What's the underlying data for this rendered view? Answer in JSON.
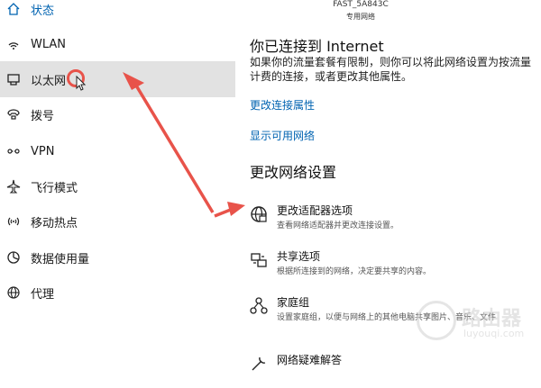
{
  "sidebar": {
    "items": [
      {
        "label": "状态",
        "icon": "home-icon"
      },
      {
        "label": "WLAN",
        "icon": "wifi-icon"
      },
      {
        "label": "以太网",
        "icon": "ethernet-icon"
      },
      {
        "label": "拨号",
        "icon": "dialup-icon"
      },
      {
        "label": "VPN",
        "icon": "vpn-icon"
      },
      {
        "label": "飞行模式",
        "icon": "airplane-icon"
      },
      {
        "label": "移动热点",
        "icon": "hotspot-icon"
      },
      {
        "label": "数据使用量",
        "icon": "data-usage-icon"
      },
      {
        "label": "代理",
        "icon": "globe-icon"
      }
    ],
    "selected_label": "以太网"
  },
  "header": {
    "ssid": "FAST_5A843C",
    "network_type": "专用网络"
  },
  "connection": {
    "title": "你已连接到 Internet",
    "description": "如果你的流量套餐有限制，则你可以将此网络设置为按流量计费的连接，或者更改其他属性。",
    "link_properties": "更改连接属性",
    "link_show_networks": "显示可用网络"
  },
  "network_settings": {
    "title": "更改网络设置",
    "options": [
      {
        "title": "更改适配器选项",
        "description": "查看网络适配器并更改连接设置。",
        "icon": "adapter-icon"
      },
      {
        "title": "共享选项",
        "description": "根据所连接到的网络，决定要共享的内容。",
        "icon": "sharing-icon"
      },
      {
        "title": "家庭组",
        "description": "设置家庭组，以便与网络上的其他电脑共享图片、音乐、文件",
        "icon": "homegroup-icon"
      },
      {
        "title": "网络疑难解答",
        "description": "",
        "icon": "troubleshoot-icon"
      }
    ]
  },
  "watermark": {
    "text": "路由器",
    "sub": "luyouqi.com"
  },
  "colors": {
    "accent": "#0063b1",
    "selected_bg": "#e2e2e2",
    "annotation_red": "#e8534a"
  }
}
